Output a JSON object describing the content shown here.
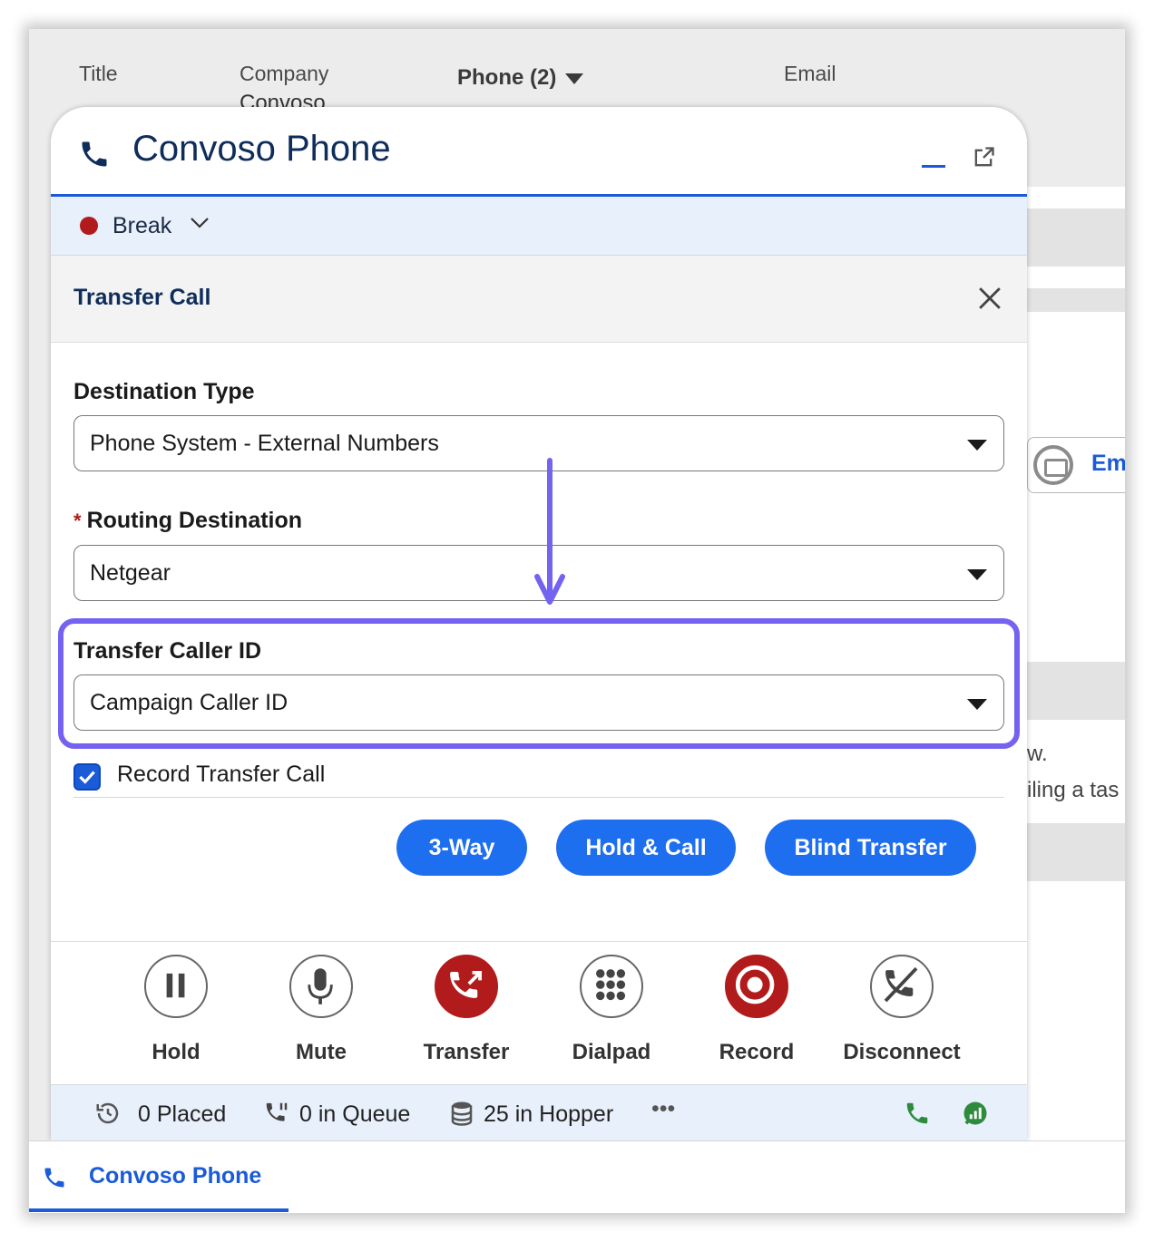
{
  "background": {
    "labels": {
      "title": "Title",
      "company": "Company",
      "phone": "Phone (2)",
      "email": "Email"
    },
    "company_value": "Convoso",
    "email_button": "Em",
    "snippets": [
      "w.",
      "iling a tas"
    ]
  },
  "phone": {
    "title": "Convoso Phone",
    "status": "Break",
    "status_color": "#b21b1b"
  },
  "transfer": {
    "heading": "Transfer Call",
    "destination_type_label": "Destination Type",
    "destination_type_value": "Phone System - External Numbers",
    "routing_label": "Routing Destination",
    "routing_required": "*",
    "routing_value": "Netgear",
    "caller_id_label": "Transfer Caller ID",
    "caller_id_value": "Campaign Caller ID",
    "record_label": "Record Transfer Call",
    "record_checked": true,
    "buttons": {
      "three_way": "3-Way",
      "hold_call": "Hold & Call",
      "blind": "Blind Transfer"
    }
  },
  "controls": {
    "hold": "Hold",
    "mute": "Mute",
    "transfer": "Transfer",
    "dialpad": "Dialpad",
    "record": "Record",
    "disconnect": "Disconnect"
  },
  "stats": {
    "placed": "0 Placed",
    "queue": "0 in Queue",
    "hopper": "25 in Hopper",
    "more": "•••"
  },
  "footer": {
    "label": "Convoso Phone"
  },
  "colors": {
    "accent": "#1b5bd8",
    "button": "#1e6ef0",
    "highlight": "#7462f0",
    "danger": "#b21b1b",
    "success": "#2e8b3d"
  }
}
